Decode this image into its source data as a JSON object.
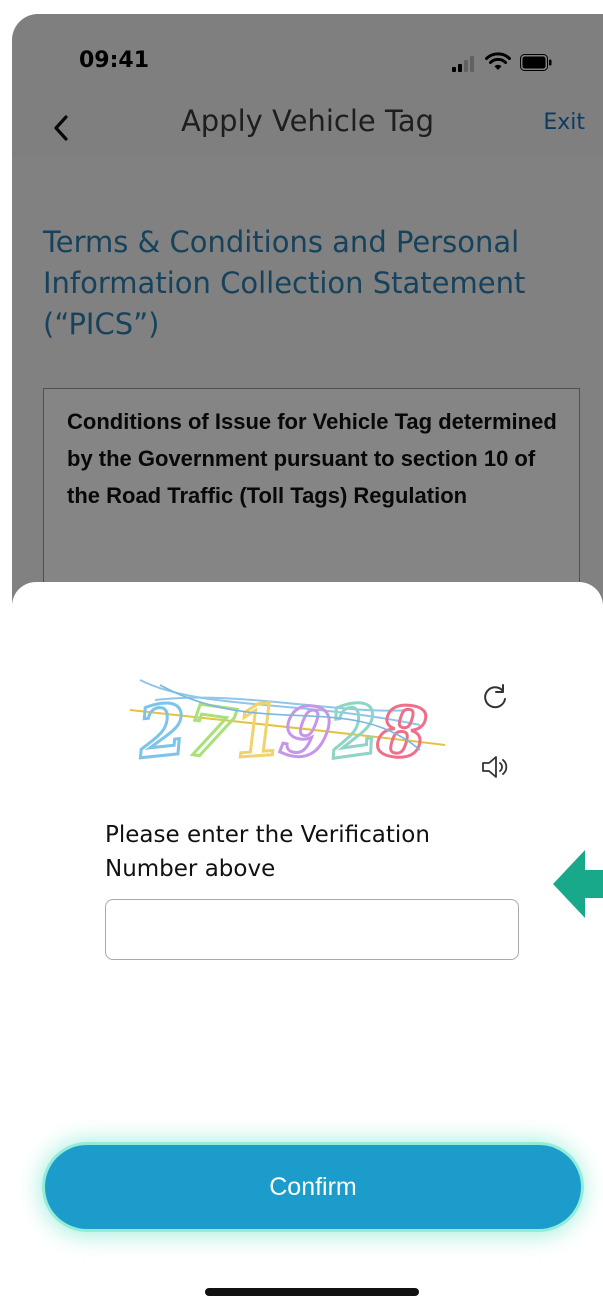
{
  "status_bar": {
    "time": "09:41"
  },
  "nav": {
    "title": "Apply Vehicle Tag",
    "exit_label": "Exit",
    "back_icon": "chevron-left-icon"
  },
  "page": {
    "heading": "Terms & Conditions and Personal Information Collection Statement (“PICS”)",
    "conditions_text": "Conditions of Issue for Vehicle Tag determined by the Government pursuant to section 10 of the Road Traffic (Toll Tags) Regulation"
  },
  "verification": {
    "captcha_code": "271928",
    "captcha_digit_colors": [
      "#7ec3ea",
      "#a8e07a",
      "#f2d36b",
      "#c896e8",
      "#8fd4c7",
      "#ef6f8a"
    ],
    "refresh_icon": "refresh-icon",
    "audio_icon": "speaker-icon",
    "prompt": "Please enter the Verification Number above",
    "input_value": "",
    "input_placeholder": ""
  },
  "actions": {
    "confirm_label": "Confirm"
  },
  "colors": {
    "accent": "#1b9ccb",
    "heading": "#2d7fb1",
    "link": "#1d6fb8",
    "pointer": "#18a98a"
  }
}
